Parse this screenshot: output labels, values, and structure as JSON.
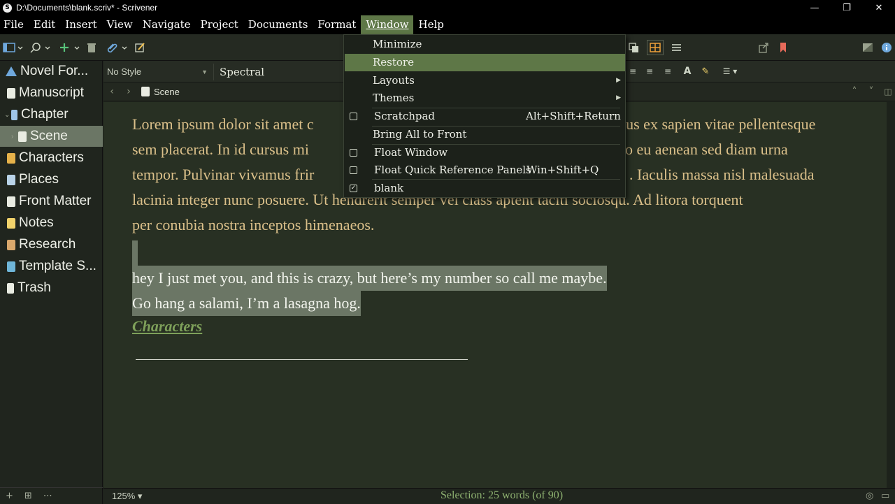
{
  "window": {
    "title": "D:\\Documents\\blank.scriv* - Scrivener",
    "app_icon": "S",
    "controls": {
      "minimize": "—",
      "restore": "❐",
      "close": "✕"
    }
  },
  "menubar": [
    "File",
    "Edit",
    "Insert",
    "View",
    "Navigate",
    "Project",
    "Documents",
    "Format",
    "Window",
    "Help"
  ],
  "active_menu": "Window",
  "window_menu": {
    "items": [
      {
        "label": "Minimize"
      },
      {
        "label": "Restore",
        "highlighted": true
      },
      {
        "label": "Layouts",
        "submenu": true
      },
      {
        "label": "Themes",
        "submenu": true
      },
      {
        "label": "Scratchpad",
        "shortcut": "Alt+Shift+Return",
        "checkbox": true,
        "checked": false
      },
      {
        "label": "Bring All to Front"
      },
      {
        "label": "Float Window",
        "checkbox": true,
        "checked": false
      },
      {
        "label": "Float Quick Reference Panels",
        "shortcut": "Win+Shift+Q",
        "checkbox": true,
        "checked": false
      },
      {
        "label": "blank",
        "checkbox": true,
        "checked": true
      }
    ]
  },
  "binder": {
    "items": [
      {
        "label": "Novel For...",
        "icon": "project-icon",
        "color": "#6fa8dc"
      },
      {
        "label": "Manuscript",
        "icon": "manuscript-icon",
        "color": "#e9ece2"
      },
      {
        "label": "Chapter",
        "icon": "folder-icon",
        "color": "#9ec5e8"
      },
      {
        "label": "Scene",
        "icon": "document-icon",
        "color": "#e9ece2"
      },
      {
        "label": "Characters",
        "icon": "characters-icon",
        "color": "#e6b24a"
      },
      {
        "label": "Places",
        "icon": "places-icon",
        "color": "#b9d3e8"
      },
      {
        "label": "Front Matter",
        "icon": "front-matter-icon",
        "color": "#e9ece2"
      },
      {
        "label": "Notes",
        "icon": "notes-icon",
        "color": "#f2d36b"
      },
      {
        "label": "Research",
        "icon": "research-icon",
        "color": "#d9a86c"
      },
      {
        "label": "Template S...",
        "icon": "template-icon",
        "color": "#6fb6d9"
      },
      {
        "label": "Trash",
        "icon": "trash-icon",
        "color": "#e9ece2"
      }
    ],
    "selected": "Scene"
  },
  "formatbar": {
    "style": "No Style",
    "font": "Spectral"
  },
  "header": {
    "doc_title": "Scene"
  },
  "editor": {
    "paragraph_lines": [
      "Lorem ipsum dolor sit amet c",
      "sem placerat. In id cursus mi",
      "tempor. Pulvinar vivamus frir",
      "lacinia integer nunc posuere. Ut hendrerit semper vel class aptent taciti sociosqu. Ad litora torquent",
      "per conubia nostra inceptos himenaeos."
    ],
    "paragraph_right": [
      "ibus ex sapien vitae pellentesque",
      "o eu aenean sed diam urna",
      ". Iaculis massa nisl malesuada"
    ],
    "selected_lines": [
      "hey I just met you, and this is crazy, but here’s my number so call me maybe.",
      "Go hang a salami, I’m a lasagna hog."
    ],
    "link_text": "Characters"
  },
  "footer": {
    "zoom": "125%",
    "status": "Selection: 25 words (of 90)"
  },
  "colors": {
    "accent": "#5e7747",
    "selection": "#6b7665",
    "body_text": "#dbc08a",
    "link": "#7ea05a",
    "status_text": "#8fb371"
  }
}
